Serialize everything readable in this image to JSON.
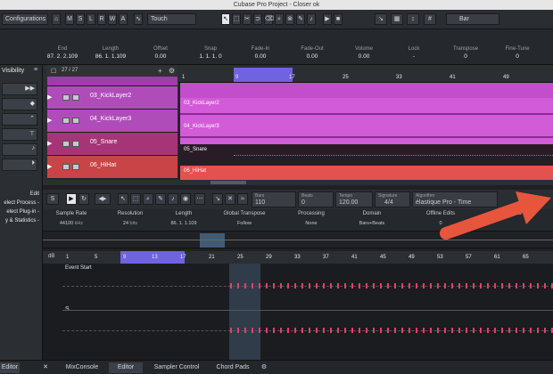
{
  "window": {
    "title": "Cubase Pro Project - Closer ok"
  },
  "toolbar": {
    "configurations": "Configurations",
    "mode_buttons": [
      "M",
      "S",
      "L",
      "R",
      "W",
      "A"
    ],
    "automation_mode": "Touch",
    "grid_type": "Bar"
  },
  "info_line": [
    {
      "label": "End",
      "value": "87. 2. 2.109"
    },
    {
      "label": "Length",
      "value": "86. 1. 1.109"
    },
    {
      "label": "Offset",
      "value": "0.00"
    },
    {
      "label": "Snap",
      "value": "1. 1. 1. 0"
    },
    {
      "label": "Fade-In",
      "value": "0.00"
    },
    {
      "label": "Fade-Out",
      "value": "0.00"
    },
    {
      "label": "Volume",
      "value": "0.00"
    },
    {
      "label": "Lock",
      "value": "-"
    },
    {
      "label": "Transpose",
      "value": "0"
    },
    {
      "label": "Fine-Tune",
      "value": "0"
    }
  ],
  "left_zone": {
    "visibility_label": "Visibility",
    "edit_label": "Edit",
    "items": [
      "elect Process -",
      "elect Plug-in -",
      "y & Statistics -"
    ],
    "footer_tab": "Editor"
  },
  "track_list": {
    "counter": "27 / 27",
    "tracks": [
      {
        "name": "03_KickLayer2",
        "color": "#c455c8"
      },
      {
        "name": "04_KickLayer3",
        "color": "#c455c8"
      },
      {
        "name": "05_Snare",
        "color": "#b03a7a"
      },
      {
        "name": "06_HiHat",
        "color": "#d6494c"
      }
    ]
  },
  "project_ruler": [
    "1",
    "9",
    "17",
    "25",
    "33",
    "41",
    "49"
  ],
  "project_events": [
    {
      "label": "03_KickLayer2",
      "color": "#d25bd8"
    },
    {
      "label": "04_KickLayer3",
      "color": "#d25bd8"
    },
    {
      "label": "05_Snare",
      "color": "#b23b7e"
    },
    {
      "label": "06_HiHat",
      "color": "#e3524f"
    }
  ],
  "editor_toolbar": {
    "bars_label": "Bars",
    "bars_value": "110",
    "beats_label": "Beats",
    "beats_value": "0",
    "tempo_label": "Tempo",
    "tempo_value": "120.00",
    "signature_label": "Signature",
    "signature_value": "4/4",
    "algorithm_label": "Algorithm",
    "algorithm_value": "élastique Pro - Time"
  },
  "sample_info": [
    {
      "label": "Sample Rate",
      "value": "44100",
      "unit": "kHz"
    },
    {
      "label": "Resolution",
      "value": "24",
      "unit": "bits"
    },
    {
      "label": "Length",
      "value": "86. 1. 1.109"
    },
    {
      "label": "Global Transpose",
      "value": "Follow"
    },
    {
      "label": "Processing",
      "value": "None"
    },
    {
      "label": "Domain",
      "value": "Bars+Beats"
    },
    {
      "label": "Offline Edits",
      "value": "0"
    },
    {
      "label": "Edits",
      "value": ""
    }
  ],
  "sample_ruler": [
    "1",
    "5",
    "9",
    "13",
    "17",
    "21",
    "25",
    "29",
    "33",
    "37",
    "41",
    "45",
    "49",
    "53",
    "57",
    "61",
    "65"
  ],
  "sample_ruler_unit": "dB",
  "event_start_label": "Event Start",
  "channel_label": "S",
  "lower_zone_tabs": [
    "MixConsole",
    "Editor",
    "Sampler Control",
    "Chord Pads"
  ]
}
